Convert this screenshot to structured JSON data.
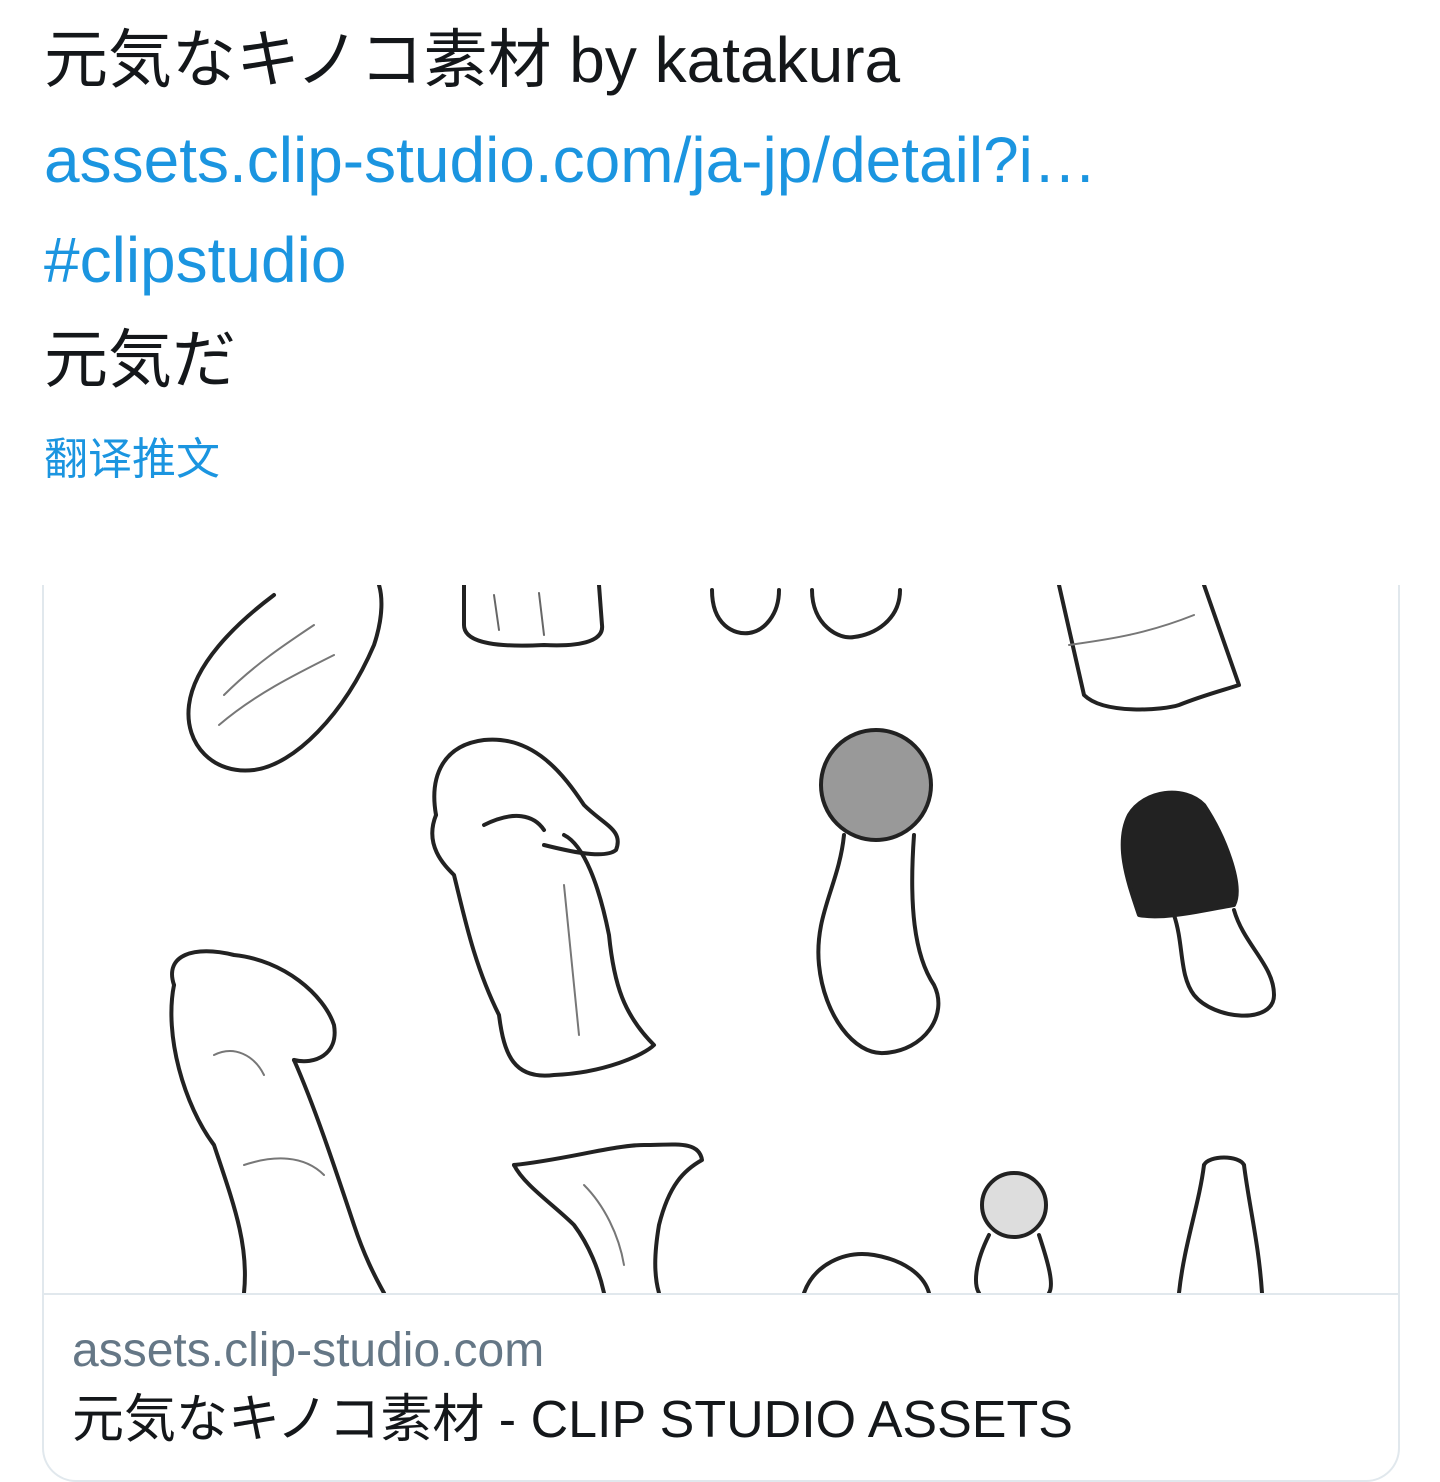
{
  "tweet": {
    "line1": "元気なキノコ素材 by katakura",
    "line2_link": "assets.clip-studio.com/ja-jp/detail?i…",
    "line3_hashtag": "#clipstudio",
    "line4": "元気だ",
    "translate_label": "翻译推文"
  },
  "card": {
    "image_name": "mushroom-illustrations",
    "domain": "assets.clip-studio.com",
    "title": "元気なキノコ素材 - CLIP STUDIO ASSETS"
  },
  "colors": {
    "link": "#1b95e0",
    "text": "#14171a",
    "muted": "#657786",
    "border": "#e1e8ed"
  }
}
